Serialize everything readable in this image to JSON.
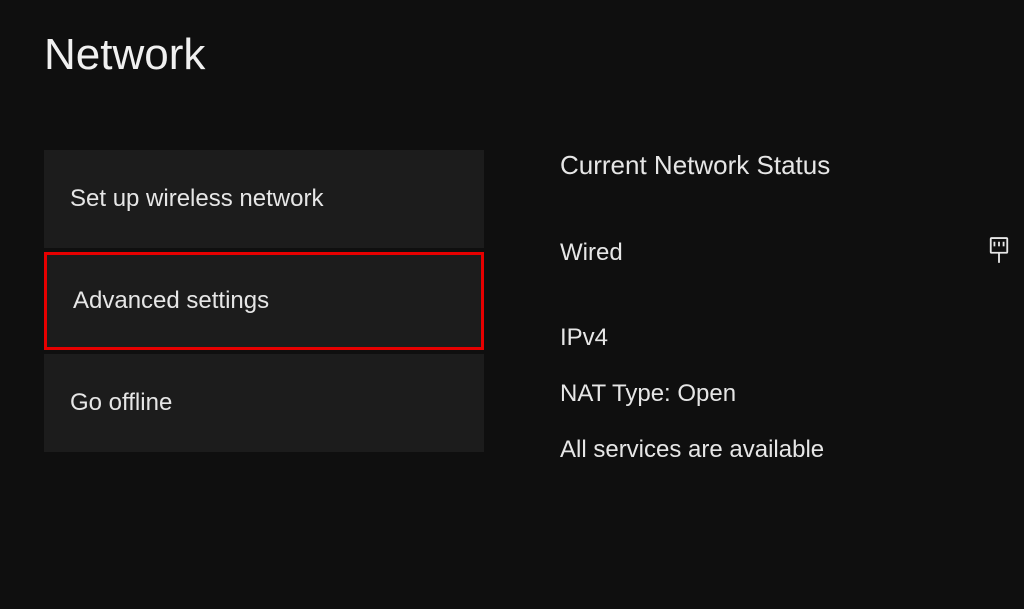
{
  "title": "Network",
  "menu": {
    "items": [
      {
        "label": "Set up wireless network",
        "highlight": false
      },
      {
        "label": "Advanced settings",
        "highlight": true
      },
      {
        "label": "Go offline",
        "highlight": false
      }
    ]
  },
  "status": {
    "heading": "Current Network Status",
    "connection_type": "Wired",
    "ip_version": "IPv4",
    "nat_line": "NAT Type: Open",
    "services_line": "All services are available",
    "icon_name": "ethernet-icon"
  }
}
